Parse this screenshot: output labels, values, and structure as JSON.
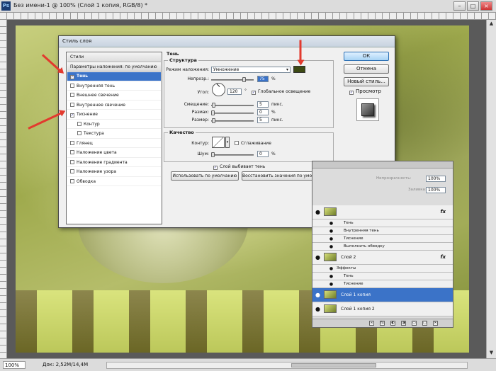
{
  "titlebar": {
    "app_icon": "Ps",
    "title": "Без имени-1 @ 100% (Слой 1 копия, RGB/8) *",
    "buttons": [
      "minimize",
      "maximize",
      "close"
    ]
  },
  "statusbar": {
    "zoom": "100%",
    "doc_info": "Док: 2,52M/14,4M"
  },
  "dialog": {
    "title": "Стиль слоя",
    "styles_list": [
      {
        "label": "Стили",
        "type": "header"
      },
      {
        "label": "Параметры наложения: по умолчанию",
        "type": "header"
      },
      {
        "label": "Тень",
        "checked": true,
        "selected": true
      },
      {
        "label": "Внутренняя тень",
        "checked": false
      },
      {
        "label": "Внешнее свечение",
        "checked": false
      },
      {
        "label": "Внутреннее свечение",
        "checked": false
      },
      {
        "label": "Тиснение",
        "checked": true
      },
      {
        "label": "Контур",
        "checked": false,
        "indent": true
      },
      {
        "label": "Текстура",
        "checked": false,
        "indent": true
      },
      {
        "label": "Глянец",
        "checked": false
      },
      {
        "label": "Наложение цвета",
        "checked": false
      },
      {
        "label": "Наложение градиента",
        "checked": false
      },
      {
        "label": "Наложение узора",
        "checked": false
      },
      {
        "label": "Обводка",
        "checked": false
      }
    ],
    "section_title": "Тень",
    "structure": {
      "label": "Структура",
      "blend_mode_label": "Режим наложения:",
      "blend_mode_value": "Умножение",
      "shadow_color": "#3d4a14",
      "opacity_label": "Непрозр.:",
      "opacity_value": "75",
      "opacity_unit": "%",
      "angle_label": "Угол:",
      "angle_value": "120",
      "angle_unit": "°",
      "global_light_label": "Глобальное освещение",
      "global_light_checked": true,
      "distance_label": "Смещение:",
      "distance_value": "5",
      "distance_unit": "пикс.",
      "spread_label": "Размах:",
      "spread_value": "0",
      "spread_unit": "%",
      "size_label": "Размер:",
      "size_value": "5",
      "size_unit": "пикс."
    },
    "quality": {
      "label": "Качество",
      "contour_label": "Контур:",
      "antialias_label": "Сглаживание",
      "noise_label": "Шум:",
      "noise_value": "0",
      "noise_unit": "%"
    },
    "knockout_label": "Слой выбивает тень",
    "make_default_button": "Использовать по умолчанию",
    "reset_default_button": "Восстановить значения по умолчанию",
    "ok_button": "ОК",
    "cancel_button": "Отмена",
    "new_style_button": "Новый стиль...",
    "preview_label": "Просмотр"
  },
  "layers_panel": {
    "opacity_label": "Непрозрачность:",
    "opacity_value": "100%",
    "fill_label": "Заливка:",
    "fill_value": "100%",
    "rows": [
      {
        "kind": "layer",
        "name": "",
        "fx": "fx"
      },
      {
        "kind": "effect",
        "name": "Тень"
      },
      {
        "kind": "effect",
        "name": "Внутренняя тень"
      },
      {
        "kind": "effect",
        "name": "Тиснение"
      },
      {
        "kind": "effect",
        "name": "Выполнить обводку"
      },
      {
        "kind": "layer",
        "name": "Слой 2",
        "fx": "fx"
      },
      {
        "kind": "effect-header",
        "name": "Эффекты"
      },
      {
        "kind": "effect",
        "name": "Тень"
      },
      {
        "kind": "effect",
        "name": "Тиснение"
      },
      {
        "kind": "layer",
        "name": "Слой 1 копия",
        "selected": true
      },
      {
        "kind": "layer",
        "name": "Слой 1 копия 2"
      }
    ],
    "footer_icons": [
      "link-icon",
      "fx-icon",
      "mask-icon",
      "adjustment-icon",
      "folder-icon",
      "new-layer-icon",
      "trash-icon"
    ]
  },
  "colors": {
    "accent_selection": "#3b73c8",
    "annotation_arrow": "#e23a2e"
  }
}
